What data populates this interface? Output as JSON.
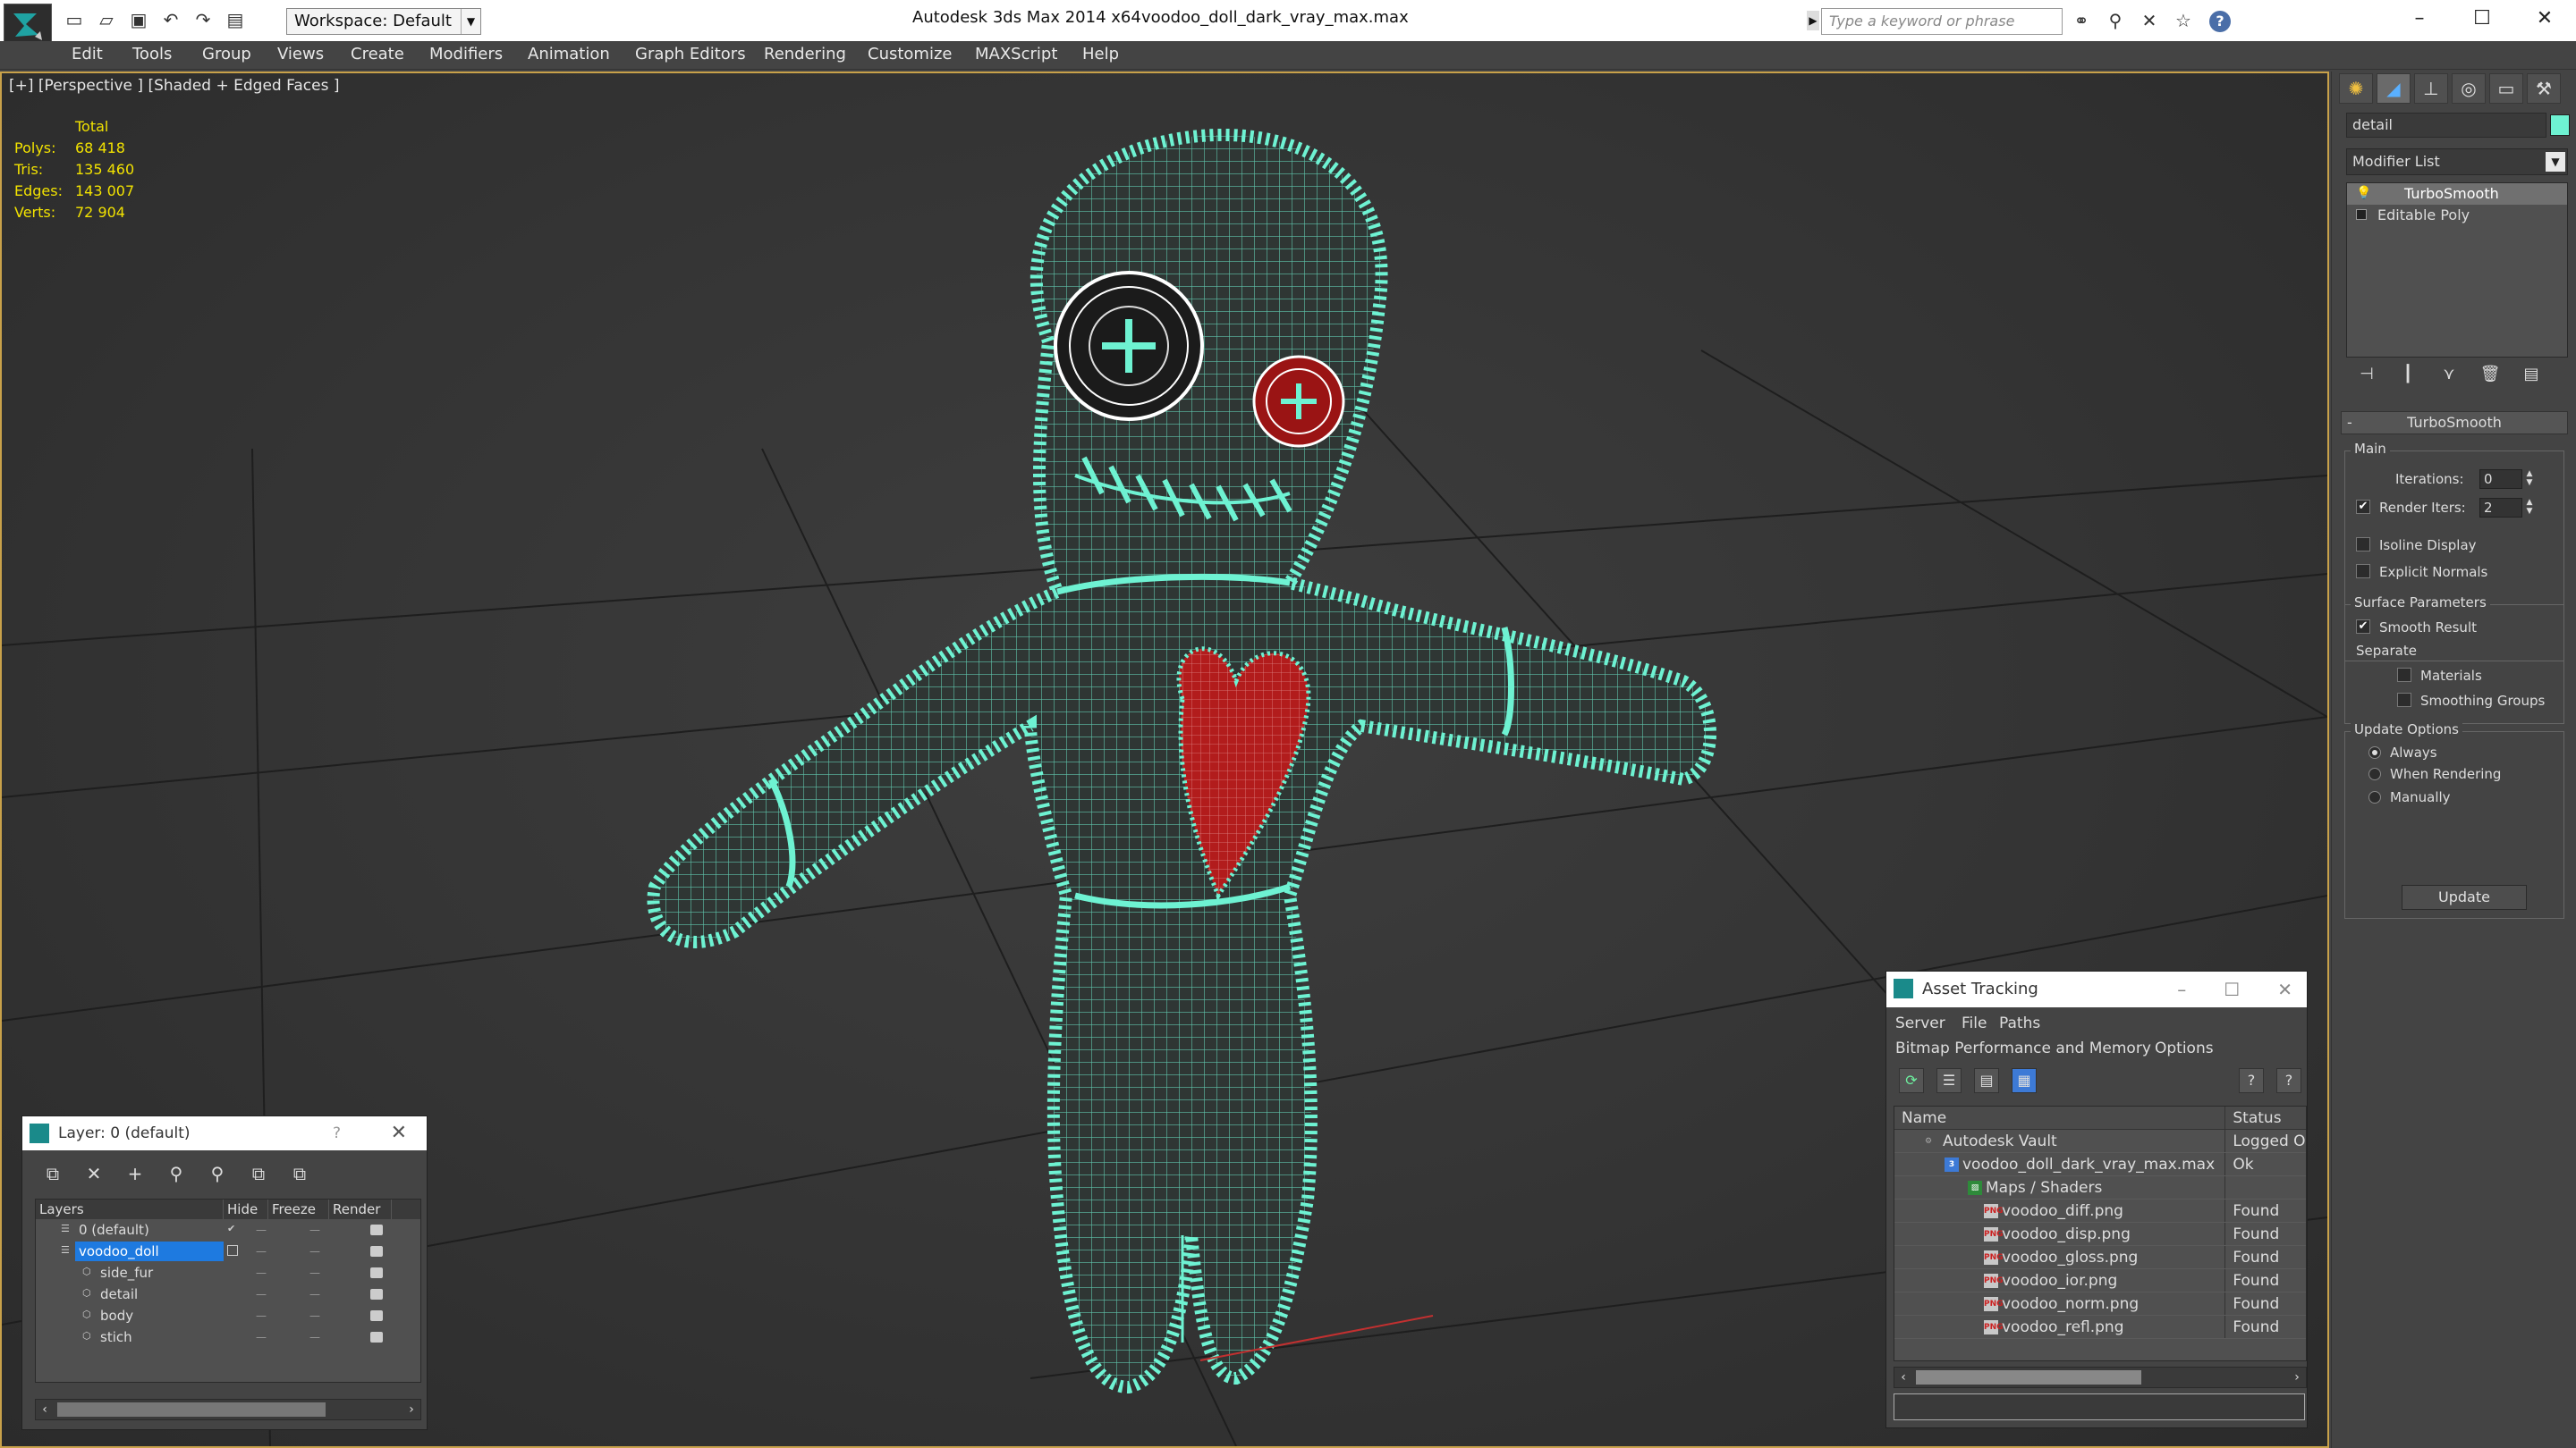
{
  "titlebar": {
    "app_title": "Autodesk 3ds Max  2014 x64",
    "file_title": "voodoo_doll_dark_vray_max.max",
    "workspace": "Workspace: Default",
    "search_placeholder": "Type a keyword or phrase",
    "help_label": "?"
  },
  "menu": [
    "Edit",
    "Tools",
    "Group",
    "Views",
    "Create",
    "Modifiers",
    "Animation",
    "Graph Editors",
    "Rendering",
    "Customize",
    "MAXScript",
    "Help"
  ],
  "viewport": {
    "label": "[+] [Perspective ] [Shaded + Edged Faces ]",
    "stats": {
      "header": "Total",
      "rows": [
        {
          "key": "Polys:",
          "value": "68 418"
        },
        {
          "key": "Tris:",
          "value": "135 460"
        },
        {
          "key": "Edges:",
          "value": "143 007"
        },
        {
          "key": "Verts:",
          "value": "72 904"
        }
      ]
    },
    "colors": {
      "wire": "#6ef2d2",
      "heart": "#b21c1c",
      "grid": "#1f1f1f",
      "accent_border": "#c8a14a"
    }
  },
  "command_panel": {
    "object_name": "detail",
    "modifier_list": "Modifier List",
    "stack": [
      "TurboSmooth",
      "Editable Poly"
    ],
    "rollout_title": "TurboSmooth",
    "main_group": "Main",
    "iterations_label": "Iterations:",
    "iterations_value": "0",
    "render_iters_label": "Render Iters:",
    "render_iters_value": "2",
    "isoline_label": "Isoline Display",
    "explicit_normals_label": "Explicit Normals",
    "surface_group": "Surface Parameters",
    "smooth_result_label": "Smooth Result",
    "separate_label": "Separate",
    "materials_label": "Materials",
    "smoothing_groups_label": "Smoothing Groups",
    "update_group": "Update Options",
    "always_label": "Always",
    "when_rendering_label": "When Rendering",
    "manually_label": "Manually",
    "update_button": "Update"
  },
  "layer_dialog": {
    "title": "Layer: 0 (default)",
    "help": "?",
    "columns": [
      "Layers",
      "Hide",
      "Freeze",
      "Render"
    ],
    "rows": [
      {
        "name": "0 (default)"
      },
      {
        "name": "voodoo_doll"
      },
      {
        "name": "side_fur"
      },
      {
        "name": "detail"
      },
      {
        "name": "body"
      },
      {
        "name": "stich"
      }
    ]
  },
  "asset_dialog": {
    "title": "Asset Tracking",
    "menu_row1": [
      "Server",
      "File",
      "Paths"
    ],
    "menu_row2": [
      "Bitmap Performance and Memory",
      "Options"
    ],
    "columns": [
      "Name",
      "Status"
    ],
    "rows": [
      {
        "name": "Autodesk Vault",
        "status": "Logged O"
      },
      {
        "name": "voodoo_doll_dark_vray_max.max",
        "status": "Ok"
      },
      {
        "name": "Maps / Shaders",
        "status": ""
      },
      {
        "name": "voodoo_diff.png",
        "status": "Found"
      },
      {
        "name": "voodoo_disp.png",
        "status": "Found"
      },
      {
        "name": "voodoo_gloss.png",
        "status": "Found"
      },
      {
        "name": "voodoo_ior.png",
        "status": "Found"
      },
      {
        "name": "voodoo_norm.png",
        "status": "Found"
      },
      {
        "name": "voodoo_refl.png",
        "status": "Found"
      }
    ]
  }
}
